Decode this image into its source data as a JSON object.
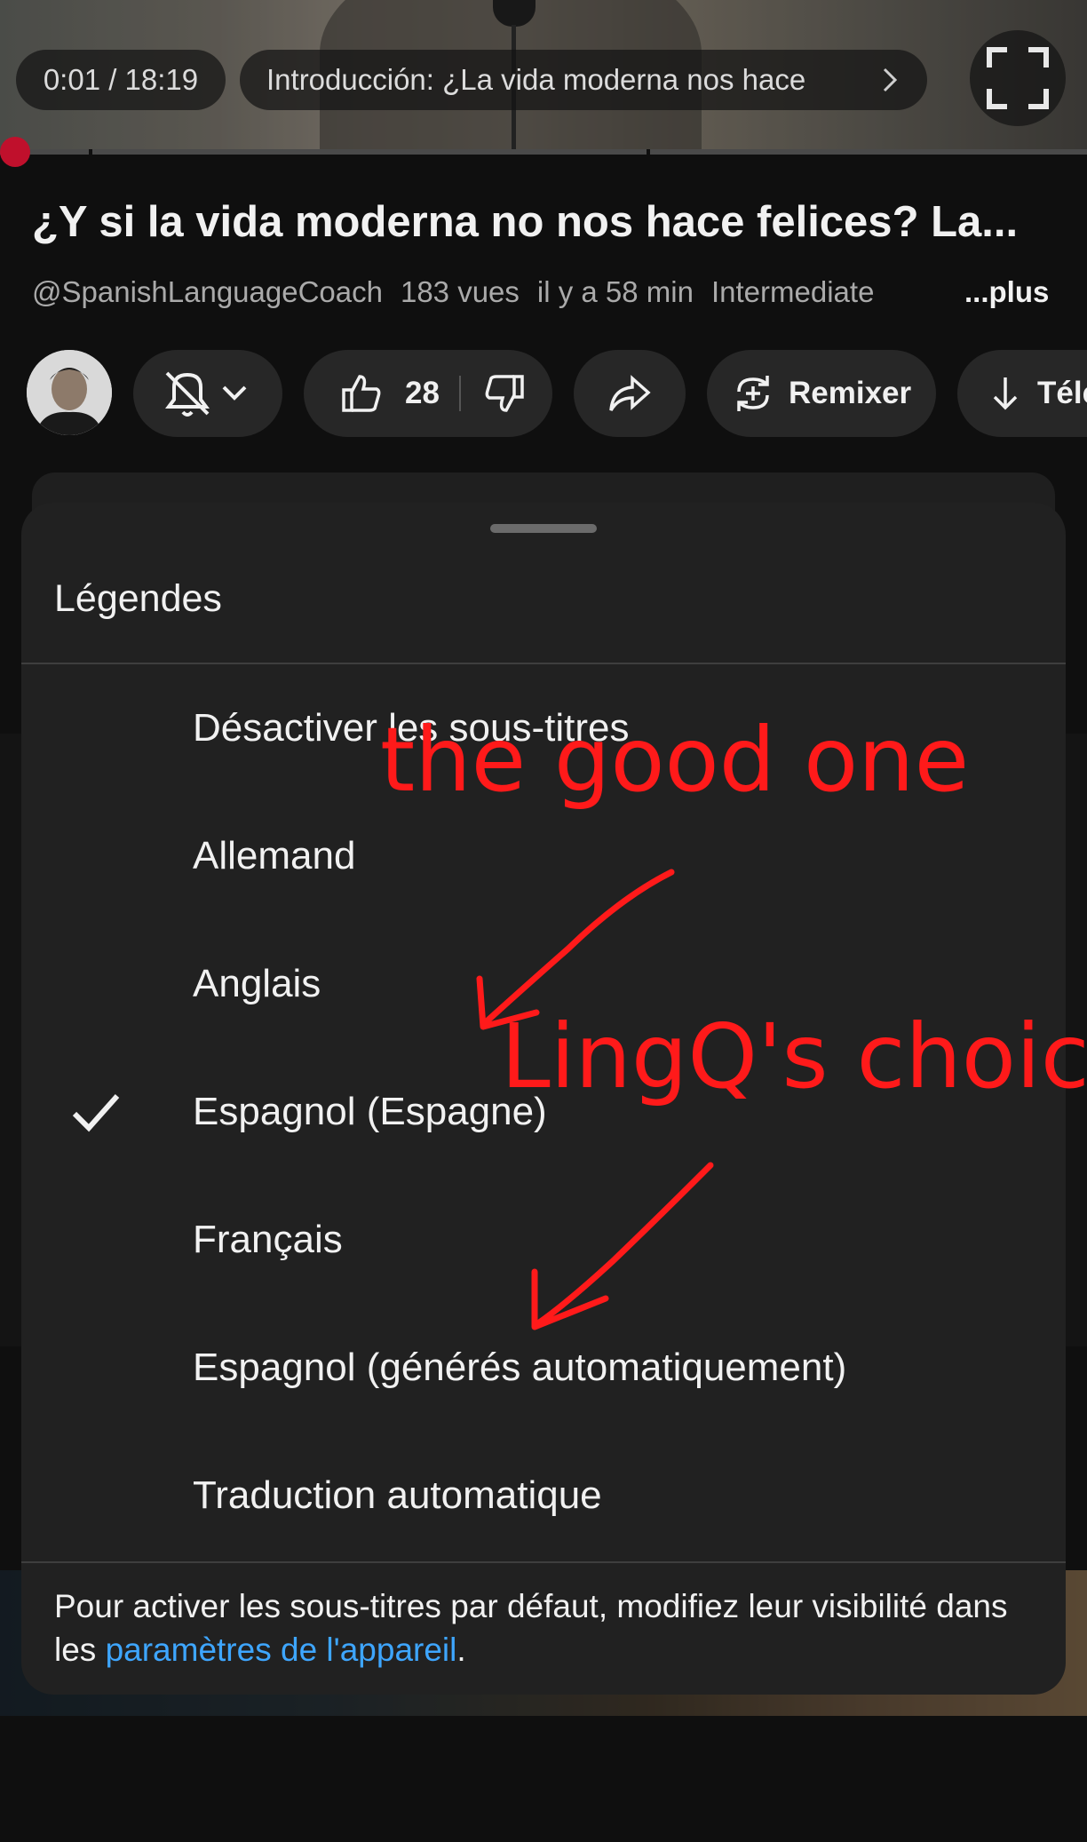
{
  "player": {
    "time": "0:01 / 18:19",
    "chapter": "Introducción: ¿La vida moderna nos hace",
    "progress_fraction": 0.0009
  },
  "video": {
    "title": "¿Y si la vida moderna no nos hace felices? La...",
    "channel": "@SpanishLanguageCoach",
    "views": "183 vues",
    "age": "il y a 58 min",
    "tag": "Intermediate",
    "more": "...plus"
  },
  "actions": {
    "likes": "28",
    "remix": "Remixer",
    "download": "Télé"
  },
  "sheet": {
    "title": "Légendes",
    "options": [
      {
        "label": "Désactiver les sous-titres",
        "selected": false
      },
      {
        "label": "Allemand",
        "selected": false
      },
      {
        "label": "Anglais",
        "selected": false
      },
      {
        "label": "Espagnol (Espagne)",
        "selected": true
      },
      {
        "label": "Français",
        "selected": false
      },
      {
        "label": "Espagnol (générés automatiquement)",
        "selected": false
      },
      {
        "label": "Traduction automatique",
        "selected": false
      }
    ],
    "footer_text": "Pour activer les sous-titres par défaut, modifiez leur visibilité dans les ",
    "footer_link": "paramètres de l'appareil",
    "footer_end": "."
  },
  "annotations": {
    "note1": "the good one",
    "note2": "LingQ's choic",
    "color": "#ff1a1a"
  },
  "colors": {
    "background": "#0f0f0f",
    "sheet": "#212121",
    "link": "#3ea6ff",
    "progress": "#c0102c"
  }
}
